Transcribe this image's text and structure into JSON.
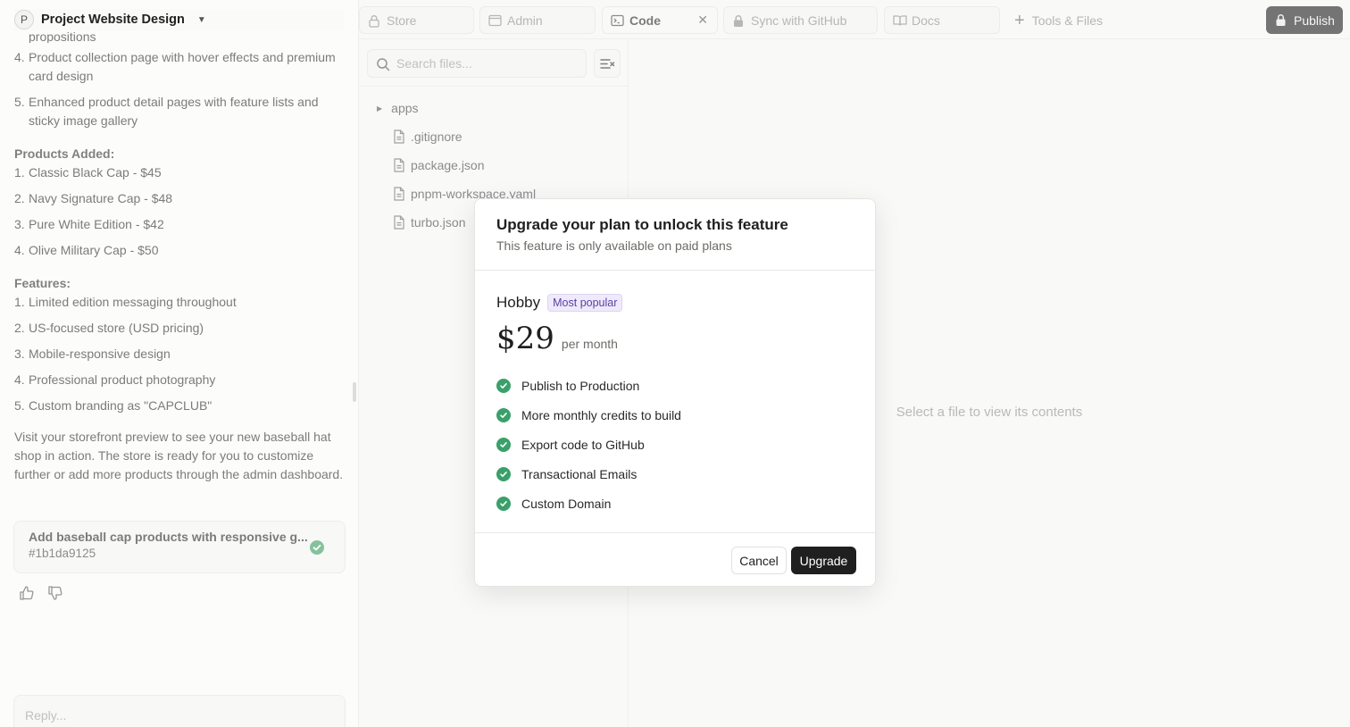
{
  "project": {
    "initial": "P",
    "name": "Project Website Design"
  },
  "chat": {
    "cut_line": "propositions",
    "top_items": [
      {
        "num": "4.",
        "text": "Product collection page with hover effects and premium card design"
      },
      {
        "num": "5.",
        "text": "Enhanced product detail pages with feature lists and sticky image gallery"
      }
    ],
    "products_heading": "Products Added:",
    "products": [
      {
        "num": "1.",
        "text": "Classic Black Cap - $45"
      },
      {
        "num": "2.",
        "text": "Navy Signature Cap - $48"
      },
      {
        "num": "3.",
        "text": "Pure White Edition - $42"
      },
      {
        "num": "4.",
        "text": "Olive Military Cap - $50"
      }
    ],
    "features_heading": "Features:",
    "features": [
      {
        "num": "1.",
        "text": "Limited edition messaging throughout"
      },
      {
        "num": "2.",
        "text": "US-focused store (USD pricing)"
      },
      {
        "num": "3.",
        "text": "Mobile-responsive design"
      },
      {
        "num": "4.",
        "text": "Professional product photography"
      },
      {
        "num": "5.",
        "text": "Custom branding as \"CAPCLUB\""
      }
    ],
    "closing": "Visit your storefront preview to see your new baseball hat shop in action. The store is ready for you to customize further or add more products through the admin dashboard.",
    "commit": {
      "title": "Add baseball cap products with responsive g...",
      "hash": "#1b1da9125"
    },
    "reply_placeholder": "Reply..."
  },
  "tabs": [
    {
      "label": "Store",
      "icon": "lock-icon"
    },
    {
      "label": "Admin",
      "icon": "window-icon"
    },
    {
      "label": "Code",
      "icon": "terminal-icon",
      "active": true
    },
    {
      "label": "Sync with GitHub",
      "icon": "lock-icon"
    },
    {
      "label": "Docs",
      "icon": "book-icon"
    }
  ],
  "tools_label": "Tools & Files",
  "publish_label": "Publish",
  "files": {
    "search_placeholder": "Search files...",
    "tree": [
      "apps",
      ".gitignore",
      "package.json",
      "pnpm-workspace.yaml",
      "turbo.json"
    ]
  },
  "viewer": {
    "empty_text": "Select a file to view its contents"
  },
  "modal": {
    "title": "Upgrade your plan to unlock this feature",
    "subtitle": "This feature is only available on paid plans",
    "plan_name": "Hobby",
    "badge": "Most popular",
    "price": "$29",
    "period": "per month",
    "features": [
      "Publish to Production",
      "More monthly credits to build",
      "Export code to GitHub",
      "Transactional Emails",
      "Custom Domain"
    ],
    "cancel_label": "Cancel",
    "upgrade_label": "Upgrade"
  },
  "colors": {
    "accent_dark": "#1f1f1f",
    "check_green": "#3aa06a",
    "badge_purple": "#5b3fa3"
  }
}
